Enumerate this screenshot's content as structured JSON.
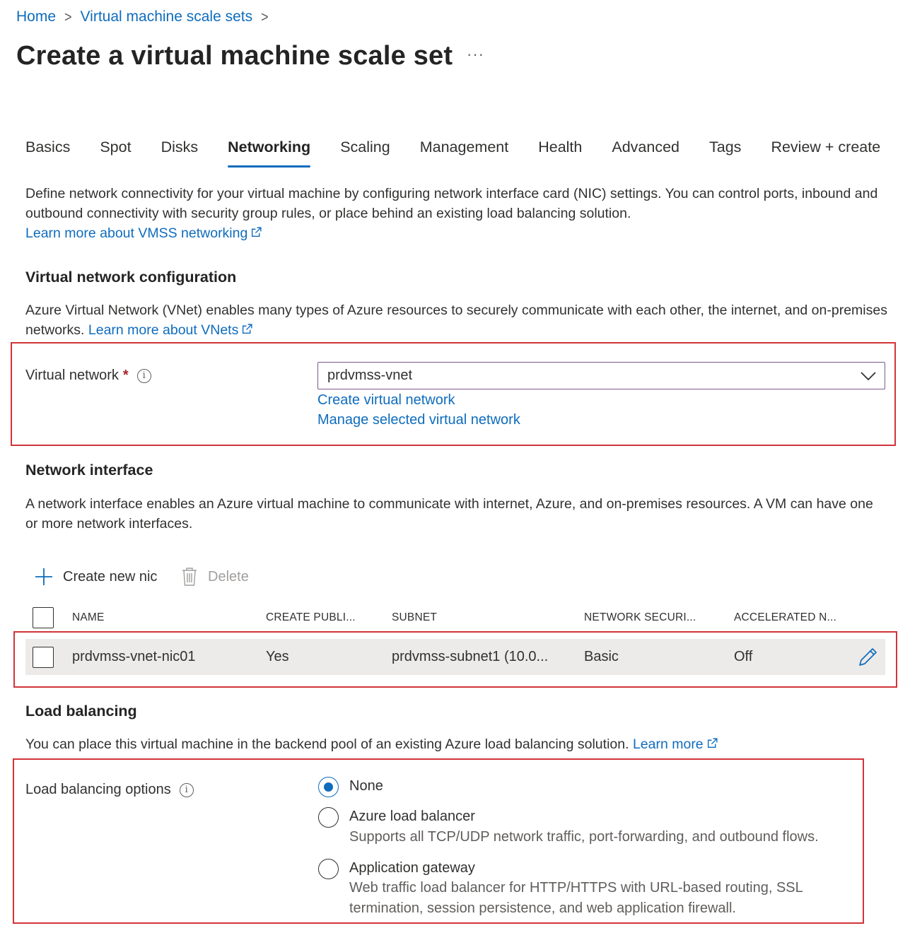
{
  "breadcrumb": {
    "home": "Home",
    "parent": "Virtual machine scale sets"
  },
  "page": {
    "title": "Create a virtual machine scale set",
    "more": "···"
  },
  "tabs": [
    {
      "label": "Basics"
    },
    {
      "label": "Spot"
    },
    {
      "label": "Disks"
    },
    {
      "label": "Networking",
      "active": true
    },
    {
      "label": "Scaling"
    },
    {
      "label": "Management"
    },
    {
      "label": "Health"
    },
    {
      "label": "Advanced"
    },
    {
      "label": "Tags"
    },
    {
      "label": "Review + create"
    }
  ],
  "intro": {
    "text": "Define network connectivity for your virtual machine by configuring network interface card (NIC) settings. You can control ports, inbound and outbound connectivity with security group rules, or place behind an existing load balancing solution.",
    "link": "Learn more about VMSS networking"
  },
  "vnet_section": {
    "title": "Virtual network configuration",
    "text": "Azure Virtual Network (VNet) enables many types of Azure resources to securely communicate with each other, the internet, and on-premises networks.",
    "link": "Learn more about VNets",
    "field_label": "Virtual network",
    "required_mark": "*",
    "info": "i",
    "selected": "prdvmss-vnet",
    "create_link": "Create virtual network",
    "manage_link": "Manage selected virtual network"
  },
  "nic_section": {
    "title": "Network interface",
    "text": "A network interface enables an Azure virtual machine to communicate with internet, Azure, and on-premises resources. A VM can have one or more network interfaces.",
    "create_label": "Create new nic",
    "delete_label": "Delete",
    "columns": [
      "NAME",
      "CREATE PUBLI...",
      "SUBNET",
      "NETWORK SECURI...",
      "ACCELERATED N..."
    ],
    "rows": [
      [
        "prdvmss-vnet-nic01",
        "Yes",
        "prdvmss-subnet1 (10.0...",
        "Basic",
        "Off"
      ]
    ]
  },
  "lb_section": {
    "title": "Load balancing",
    "text": "You can place this virtual machine in the backend pool of an existing Azure load balancing solution.",
    "link": "Learn more",
    "field_label": "Load balancing options",
    "info": "i",
    "options": [
      {
        "label": "None",
        "checked": true,
        "desc": ""
      },
      {
        "label": "Azure load balancer",
        "checked": false,
        "desc": "Supports all TCP/UDP network traffic, port-forwarding, and outbound flows."
      },
      {
        "label": "Application gateway",
        "checked": false,
        "desc": "Web traffic load balancer for HTTP/HTTPS with URL-based routing, SSL termination, session persistence, and web application firewall."
      }
    ]
  },
  "colors": {
    "accent": "#0f6cbd",
    "highlight": "#d13438",
    "row_bg": "#edebe9"
  }
}
